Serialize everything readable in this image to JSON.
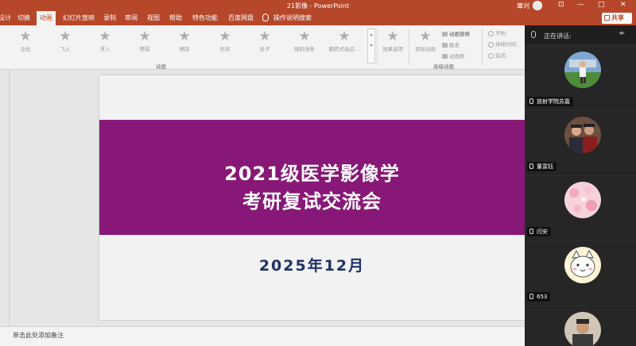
{
  "app": {
    "title": "21影像 - PowerPoint",
    "user": "肇刈",
    "window_controls": [
      "⊡",
      "—",
      "□",
      "✕"
    ]
  },
  "tabs": [
    {
      "label": "设计"
    },
    {
      "label": "切换"
    },
    {
      "label": "动画",
      "active": true
    },
    {
      "label": "幻灯片放映"
    },
    {
      "label": "录制"
    },
    {
      "label": "审阅"
    },
    {
      "label": "视图"
    },
    {
      "label": "帮助"
    },
    {
      "label": "特色功能"
    },
    {
      "label": "百度网盘"
    }
  ],
  "tell_me": "操作说明搜索",
  "share_label": "共享",
  "ribbon": {
    "animations": [
      "淡化",
      "飞入",
      "浮入",
      "劈裂",
      "擦除",
      "形状",
      "轮子",
      "随机线条",
      "翻转式由远..."
    ],
    "group_animation_label": "动画",
    "effect_options": "效果选项",
    "add_animation": "添加动画",
    "animation_pane": "动画窗格",
    "trigger": "触发",
    "animation_painter": "动画刷",
    "group_advanced_label": "高级动画",
    "timing": [
      "开始:",
      "持续时间:",
      "延迟:"
    ]
  },
  "slide": {
    "title_line1": "2021级医学影像学",
    "title_line2": "考研复试交流会",
    "date": "2025年12月",
    "band_color": "#871877",
    "date_color": "#1f3267"
  },
  "notes_placeholder": "单击此处添加备注",
  "meeting": {
    "header": "正在讲话:",
    "participants": [
      {
        "name": "放射学院苏嘉",
        "face": "soccer-photo"
      },
      {
        "name": "董富钰",
        "face": "group-photo"
      },
      {
        "name": "闫安",
        "face": "pink-flowers"
      },
      {
        "name": "653",
        "face": "cartoon-cat"
      },
      {
        "name": "",
        "face": "person-photo"
      }
    ]
  },
  "colors": {
    "accent": "#b7472a",
    "panel_bg": "#1e1e1e"
  }
}
